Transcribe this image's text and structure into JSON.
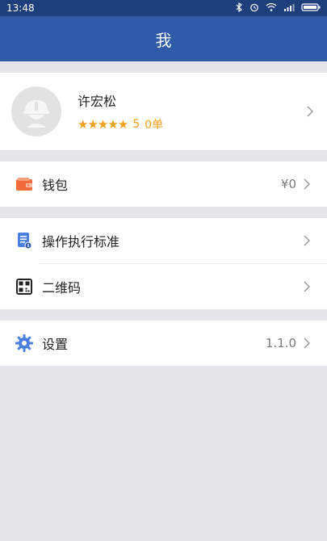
{
  "status": {
    "time": "13:48"
  },
  "header": {
    "title": "我"
  },
  "profile": {
    "name": "许宏松",
    "stars": "★★★★★",
    "rating": "5",
    "orders": "0单"
  },
  "wallet": {
    "label": "钱包",
    "value": "¥0"
  },
  "menu": {
    "standard_label": "操作执行标准",
    "qrcode_label": "二维码"
  },
  "settings": {
    "label": "设置",
    "version": "1.1.0"
  },
  "colors": {
    "nav": "#2f5ba9",
    "status_bar": "#1f3f7c",
    "accent_orange": "#f0a11b",
    "background": "#e6e6ea"
  }
}
